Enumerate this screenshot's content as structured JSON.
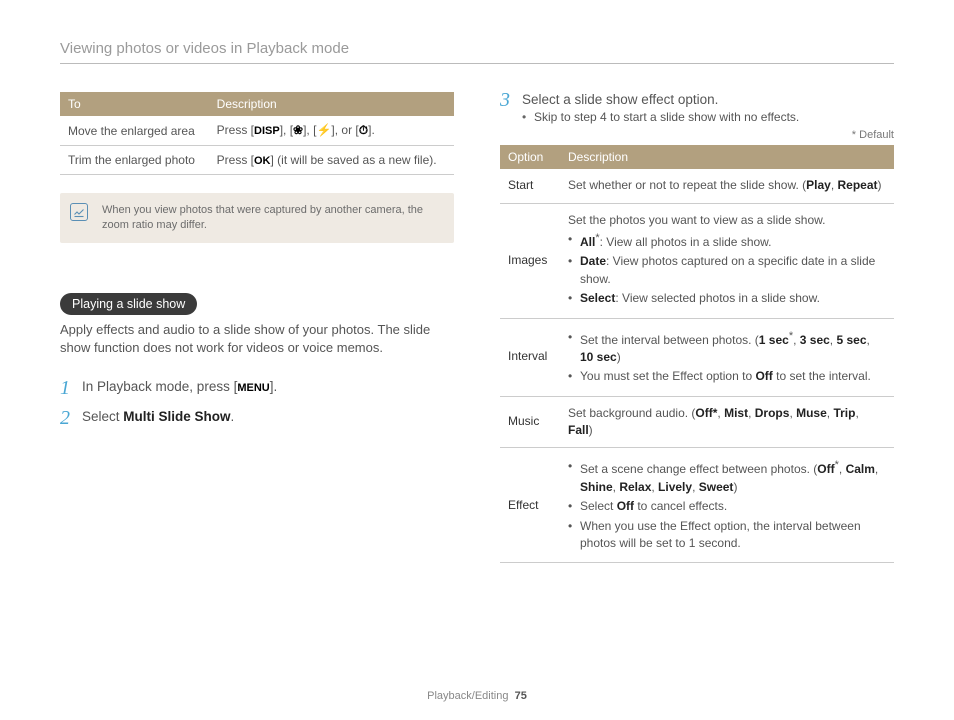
{
  "header": {
    "title": "Viewing photos or videos in Playback mode"
  },
  "leftTable": {
    "head": {
      "c1": "To",
      "c2": "Description"
    },
    "rows": [
      {
        "label": "Move the enlarged area",
        "pre": "Press [",
        "disp": "DISP",
        "mid1": "], [",
        "g1": "❀",
        "mid2": "], [",
        "g2": "⚡",
        "mid3": "], or [",
        "g3": "⏱",
        "post": "]."
      },
      {
        "label": "Trim the enlarged photo",
        "pre": "Press [",
        "ok": "OK",
        "post": "] (it will be saved as a new file)."
      }
    ]
  },
  "note": {
    "text": "When you view photos that were captured by another camera, the zoom ratio may differ."
  },
  "section": {
    "pill": "Playing a slide show",
    "intro": "Apply effects and audio to a slide show of your photos. The slide show function does not work for videos or voice memos.",
    "steps": {
      "s1_pre": "In Playback mode, press [",
      "s1_menu": "MENU",
      "s1_post": "].",
      "s2_pre": "Select ",
      "s2_bold": "Multi Slide Show",
      "s2_post": "."
    }
  },
  "right": {
    "step_num": "3",
    "step_title": "Select a slide show effect option.",
    "skip": "Skip to step 4 to start a slide show with no effects.",
    "default_note": "* Default",
    "table": {
      "head": {
        "c1": "Option",
        "c2": "Description"
      },
      "start": {
        "name": "Start",
        "text_pre": "Set whether or not to repeat the slide show. (",
        "b1": "Play",
        "comma": ", ",
        "b2": "Repeat",
        "text_post": ")"
      },
      "images": {
        "name": "Images",
        "line1": "Set the photos you want to view as a slide show.",
        "all_b": "All",
        "all_star": "*",
        "all_post": ": View all photos in a slide show.",
        "date_b": "Date",
        "date_post": ": View photos captured on a specific date in a slide show.",
        "select_b": "Select",
        "select_post": ": View selected photos in a slide show."
      },
      "interval": {
        "name": "Interval",
        "l1_pre": "Set the interval between photos. (",
        "l1_b1": "1 sec",
        "l1_star": "*",
        "l1_c1": ", ",
        "l1_b2": "3 sec",
        "l1_c2": ", ",
        "l1_b3": "5 sec",
        "l1_c3": ", ",
        "l1_b4": "10 sec",
        "l1_post": ")",
        "l2_pre": "You must set the Effect option to ",
        "l2_b": "Off",
        "l2_post": " to set the interval."
      },
      "music": {
        "name": "Music",
        "pre": "Set background audio. (",
        "b1": "Off*",
        "c1": ", ",
        "b2": "Mist",
        "c2": ", ",
        "b3": "Drops",
        "c3": ", ",
        "b4": "Muse",
        "c4": ", ",
        "b5": "Trip",
        "c5": ", ",
        "b6": "Fall",
        "post": ")"
      },
      "effect": {
        "name": "Effect",
        "l1_pre": "Set a scene change effect between photos. (",
        "l1_b1": "Off",
        "l1_star": "*",
        "l1_c1": ", ",
        "l1_b2": "Calm",
        "l1_c2": ", ",
        "l1_b3": "Shine",
        "l1_c3": ", ",
        "l1_b4": "Relax",
        "l1_c4": ", ",
        "l1_b5": "Lively",
        "l1_c5": ", ",
        "l1_b6": "Sweet",
        "l1_post": ")",
        "l2_pre": "Select ",
        "l2_b": "Off",
        "l2_post": " to cancel effects.",
        "l3": "When you use the Effect option, the interval between photos will be set to 1 second."
      }
    }
  },
  "footer": {
    "section": "Playback/Editing",
    "page": "75"
  }
}
